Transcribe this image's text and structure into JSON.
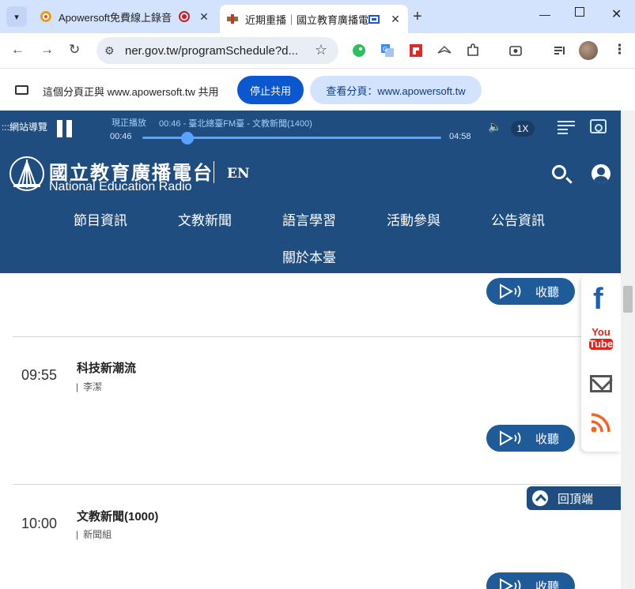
{
  "browser": {
    "tabs": [
      {
        "title": "Apowersoft免費線上錄音",
        "recording": true
      },
      {
        "title": "近期重播｜國立教育廣播電",
        "active": true
      }
    ],
    "url": "ner.gov.tw/programSchedule?d...",
    "sharing": {
      "message": "這個分頁正與 www.apowersoft.tw 共用",
      "stop_label": "停止共用",
      "view_label": "查看分頁：www.apowersoft.tw"
    }
  },
  "player": {
    "skip_label": ":::網站導覽",
    "now_label": "現正播放",
    "now_title": "00:46 - 臺北總臺FM臺 - 文教新聞(1400)",
    "current_time": "00:46",
    "end_time": "04:58",
    "progress_fraction": 0.15,
    "speed": "1X"
  },
  "site": {
    "logo_zh": "國立教育廣播電台",
    "logo_en": "National Education Radio",
    "lang_link": "EN",
    "nav": [
      "節目資訊",
      "文教新聞",
      "語言學習",
      "活動參與",
      "公告資訊",
      "關於本臺"
    ]
  },
  "schedule": {
    "listen_label": "收聽",
    "programs": [
      {
        "time": "09:55",
        "title": "科技新潮流",
        "host": "李潔"
      },
      {
        "time": "10:00",
        "title": "文教新聞(1000)",
        "host": "新聞組"
      }
    ]
  },
  "social": {
    "youtube_top": "You",
    "youtube_bottom": "Tube"
  },
  "back_to_top": "回頂端",
  "colors": {
    "brand": "#1f4d7f",
    "button": "#1f5a99",
    "accent": "#5aa2ff"
  }
}
